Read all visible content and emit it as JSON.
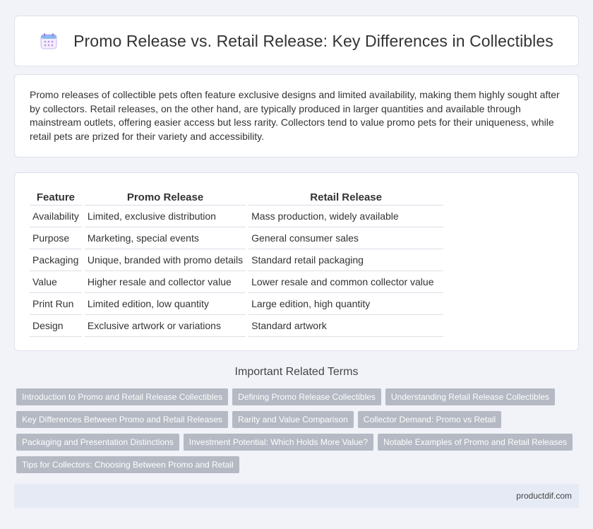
{
  "header": {
    "title": "Promo Release vs. Retail Release: Key Differences in Collectibles",
    "icon": "calendar-icon"
  },
  "intro": {
    "text": "Promo releases of collectible pets often feature exclusive designs and limited availability, making them highly sought after by collectors. Retail releases, on the other hand, are typically produced in larger quantities and available through mainstream outlets, offering easier access but less rarity. Collectors tend to value promo pets for their uniqueness, while retail pets are prized for their variety and accessibility."
  },
  "table": {
    "headers": [
      "Feature",
      "Promo Release",
      "Retail Release"
    ],
    "rows": [
      [
        "Availability",
        "Limited, exclusive distribution",
        "Mass production, widely available"
      ],
      [
        "Purpose",
        "Marketing, special events",
        "General consumer sales"
      ],
      [
        "Packaging",
        "Unique, branded with promo details",
        "Standard retail packaging"
      ],
      [
        "Value",
        "Higher resale and collector value",
        "Lower resale and common collector value"
      ],
      [
        "Print Run",
        "Limited edition, low quantity",
        "Large edition, high quantity"
      ],
      [
        "Design",
        "Exclusive artwork or variations",
        "Standard artwork"
      ]
    ]
  },
  "related": {
    "title": "Important Related Terms",
    "tags": [
      "Introduction to Promo and Retail Release Collectibles",
      "Defining Promo Release Collectibles",
      "Understanding Retail Release Collectibles",
      "Key Differences Between Promo and Retail Releases",
      "Rarity and Value Comparison",
      "Collector Demand: Promo vs Retail",
      "Packaging and Presentation Distinctions",
      "Investment Potential: Which Holds More Value?",
      "Notable Examples of Promo and Retail Releases",
      "Tips for Collectors: Choosing Between Promo and Retail"
    ]
  },
  "footer": {
    "text": "productdif.com"
  }
}
